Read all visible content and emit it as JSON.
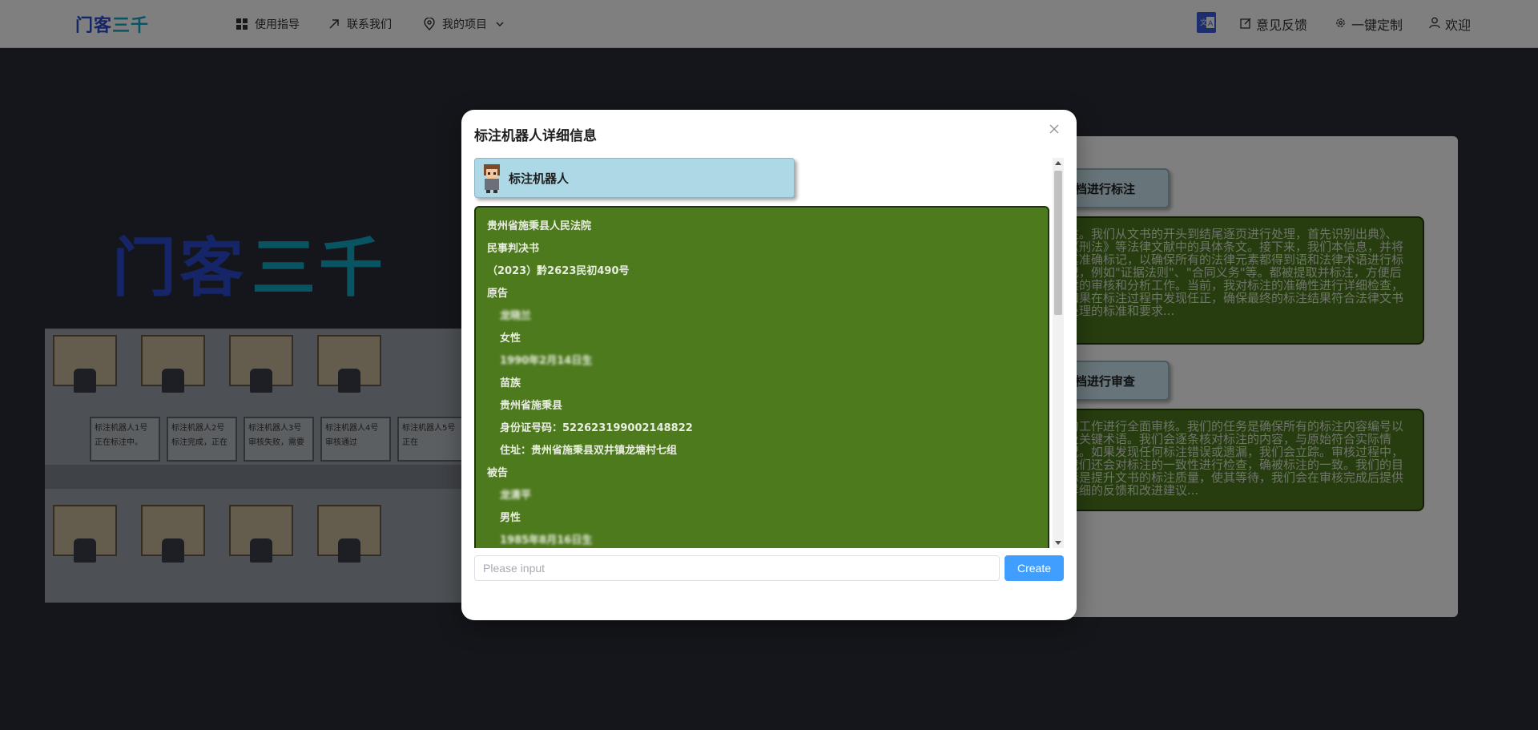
{
  "nav": {
    "logo_text": "门客三千",
    "items": [
      {
        "label": "使用指导",
        "icon": "grid-icon"
      },
      {
        "label": "联系我们",
        "icon": "arrow-up-right-icon"
      },
      {
        "label": "我的项目",
        "icon": "location-pin-icon"
      }
    ],
    "right": {
      "translate_icon": "translate-icon",
      "feedback": "意见反馈",
      "customize": "一键定制",
      "welcome": "欢迎"
    }
  },
  "background": {
    "big_logo": "门客三千",
    "office_labels": [
      {
        "name": "标注机器人1号",
        "status": "正在标注中。"
      },
      {
        "name": "标注机器人2号",
        "status": "标注完成，正在"
      },
      {
        "name": "标注机器人3号",
        "status": "审核失败，需要"
      },
      {
        "name": "标注机器人4号",
        "status": "审核通过"
      },
      {
        "name": "标注机器人5号",
        "status": "正在"
      }
    ],
    "panel": {
      "tag1": "档进行标注",
      "text1": "注。我们从文书的开头到结尾逐页进行处理，首先识别出典》、《刑法》等法律文献中的具体条文。接下来，我们本信息，并将其准确标记，以确保所有的法律元素都得到语和法律术语进行标记，例如\"证据法则\"、\"合同义务\"等。都被提取并标注，方便后续的审核和分析工作。当前，我对标注的准确性进行详细检查，如果在标注过程中发现任正，确保最终的标注结果符合法律文书处理的标准和要求...",
      "tag2": "档进行审查",
      "text2": "的工作进行全面审核。我们的任务是确保所有的标注内容编号以及关键术语。我们会逐条核对标注的内容，与原始符合实际情况。如果发现任何标注错误或遗漏，我们会立踪。审核过程中，我们还会对标注的一致性进行检查，确被标注的一致。我们的目标是提升文书的标注质量，使其等待，我们会在审核完成后提供详细的反馈和改进建议..."
    }
  },
  "modal": {
    "title": "标注机器人详细信息",
    "robot_name": "标注机器人",
    "document_lines": [
      {
        "text": "贵州省施秉县人民法院",
        "indent": false,
        "blur": false
      },
      {
        "text": "民事判决书",
        "indent": false,
        "blur": false
      },
      {
        "text": "（2023）黔2623民初490号",
        "indent": false,
        "blur": false
      },
      {
        "text": "原告",
        "indent": false,
        "blur": false
      },
      {
        "text": "龙晓兰",
        "indent": true,
        "blur": true
      },
      {
        "text": "女性",
        "indent": true,
        "blur": false
      },
      {
        "text": "1990年2月14日生",
        "indent": true,
        "blur": true
      },
      {
        "text": "苗族",
        "indent": true,
        "blur": false
      },
      {
        "text": "贵州省施秉县",
        "indent": true,
        "blur": false
      },
      {
        "text": "身份证号码：522623199002148822",
        "indent": true,
        "blur": false
      },
      {
        "text": "住址：贵州省施秉县双井镇龙塘村七组",
        "indent": true,
        "blur": false
      },
      {
        "text": "被告",
        "indent": false,
        "blur": false
      },
      {
        "text": "龙清平",
        "indent": true,
        "blur": true
      },
      {
        "text": "男性",
        "indent": true,
        "blur": false
      },
      {
        "text": "1985年8月16日生",
        "indent": true,
        "blur": true
      }
    ],
    "input_placeholder": "Please input",
    "create_label": "Create"
  },
  "colors": {
    "brand_blue": "#2b4bd1",
    "brand_teal": "#13a8c6",
    "doc_green": "#4e7a1e",
    "robot_card": "#add8e6",
    "primary_button": "#409eff"
  }
}
